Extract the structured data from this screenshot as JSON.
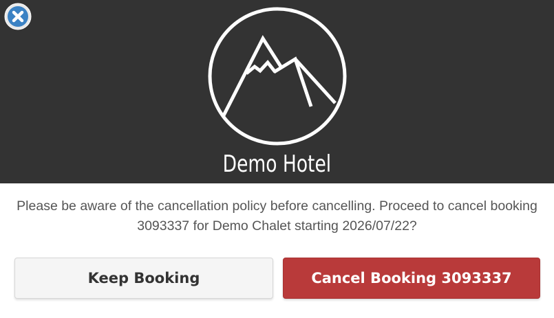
{
  "header": {
    "close_icon": "close-icon",
    "logo_icon": "mountain-logo-icon",
    "brand_name": "Demo Hotel"
  },
  "dialog": {
    "message": "Please be aware of the cancellation policy before cancelling. Proceed to cancel booking 3093337 for Demo Chalet starting 2026/07/22?"
  },
  "actions": {
    "keep_label": "Keep Booking",
    "cancel_label": "Cancel Booking 3093337"
  },
  "colors": {
    "header_bg": "#333333",
    "cancel_button": "#b93a3a",
    "keep_button": "#f5f5f5",
    "close_icon_blue": "#3b82c4"
  }
}
